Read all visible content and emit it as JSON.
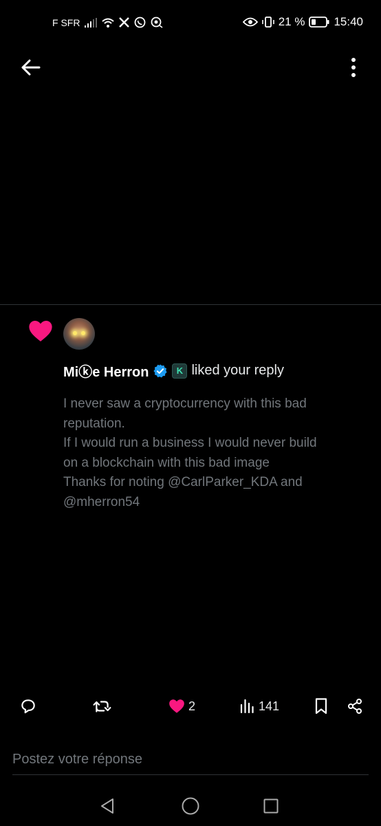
{
  "status_bar": {
    "carrier": "F SFR",
    "battery_percent": "21 %",
    "time": "15:40",
    "icons": [
      "signal-icon",
      "wifi-icon",
      "x-app-icon",
      "whatsapp-icon",
      "notification-app-icon",
      "eye-icon",
      "vibrate-icon",
      "battery-icon"
    ]
  },
  "header": {
    "back_icon": "arrow-left-icon",
    "more_icon": "vertical-dots-icon"
  },
  "notification": {
    "type_icon": "heart-icon",
    "actor_name": "Miⓚe Herron",
    "verified_icon": "verified-badge-icon",
    "affiliate_badge": "K",
    "action_text": "liked your reply",
    "reply_lines": [
      "I never saw a cryptocurrency with this bad",
      "reputation.",
      "If I would run a business I would never build",
      "on a blockchain with this bad image",
      "Thanks for noting @CarlParker_KDA and",
      "@mherron54"
    ]
  },
  "actions": {
    "likes_count": "2",
    "views_count": "141"
  },
  "compose": {
    "placeholder": "Postez votre réponse"
  },
  "colors": {
    "background": "#000000",
    "like_pink": "#f91880",
    "verified_blue": "#1d9bf0",
    "muted_text": "#71767b",
    "primary_text": "#e7e9ea"
  }
}
